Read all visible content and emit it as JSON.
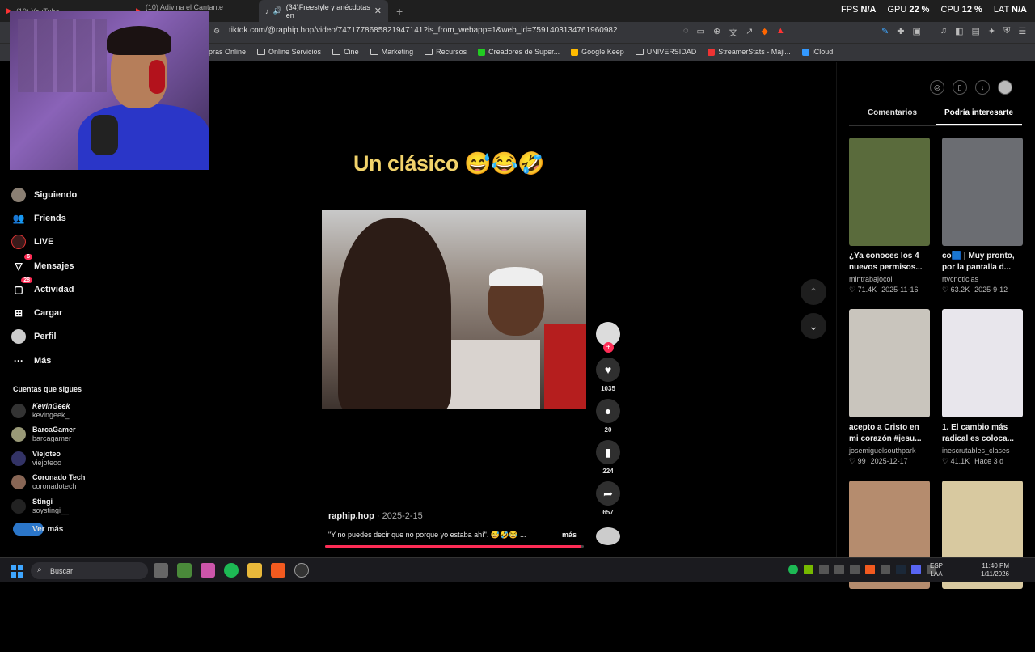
{
  "browser": {
    "tabs": [
      {
        "label": "(10) YouTube"
      },
      {
        "label": "(10) Adivina el Cantante Profesional"
      },
      {
        "label": "(34)Freestyle y anécdotas en"
      }
    ],
    "url": "tiktok.com/@raphip.hop/video/7471778685821947141?is_from_webapp=1&web_id=7591403134761960982",
    "bookmarks": [
      "pras Online",
      "Online Servicios",
      "Cine",
      "Marketing",
      "Recursos",
      "Creadores de Super...",
      "Google Keep",
      "UNIVERSIDAD",
      "StreamerStats - Maji...",
      "iCloud"
    ]
  },
  "hud": {
    "fps_label": "FPS",
    "fps_value": "N/A",
    "gpu_label": "GPU",
    "gpu_value": "22 %",
    "cpu_label": "CPU",
    "cpu_value": "12 %",
    "lat_label": "LAT",
    "lat_value": "N/A"
  },
  "nav": {
    "siguiendo": "Siguiendo",
    "friends": "Friends",
    "live": "LIVE",
    "mensajes": "Mensajes",
    "mensajes_badge": "6",
    "actividad": "Actividad",
    "actividad_badge": "28",
    "cargar": "Cargar",
    "perfil": "Perfil",
    "mas": "Más"
  },
  "follows": {
    "title": "Cuentas que sigues",
    "items": [
      {
        "name": "KevinGeek",
        "handle": "kevingeek_"
      },
      {
        "name": "BarcaGamer",
        "handle": "barcagamer"
      },
      {
        "name": "Viejoteo",
        "handle": "viejoteoo"
      },
      {
        "name": "Coronado Tech",
        "handle": "coronadotech"
      },
      {
        "name": "Stingi",
        "handle": "soystingi__"
      }
    ],
    "ver_mas": "Ver más"
  },
  "video": {
    "overlay_title": "Un clásico 😅😂🤣",
    "author": "raphip.hop",
    "date": " · 2025-2-15",
    "description": "\"Y no puedes decir que no porque yo estaba ahí\". 😅🤣😂 ...",
    "more": "más",
    "progress": 0.99,
    "likes": "1035",
    "comments": "20",
    "saves": "224",
    "shares": "657"
  },
  "sidebar": {
    "tab_comments": "Comentarios",
    "tab_suggested": "Podría interesarte",
    "cards": [
      {
        "title": "¿Ya conoces los 4 nuevos permisos...",
        "author": "mintrabajocol",
        "likes": "♡ 71.4K",
        "date": "2025-11-16",
        "color": "#5a6b3c"
      },
      {
        "title": "co🟦 | Muy pronto, por la pantalla d...",
        "author": "rtvcnoticias",
        "likes": "♡ 63.2K",
        "date": "2025-9-12",
        "color": "#6b6d72"
      },
      {
        "title": "acepto a Cristo en mi corazón #jesu...",
        "author": "josemiguelsouthpark",
        "likes": "♡ 99",
        "date": "2025-12-17",
        "color": "#c9c5bd"
      },
      {
        "title": "1. El cambio más radical es coloca...",
        "author": "inescrutables_clases",
        "likes": "♡ 41.1K",
        "date": "Hace 3 d",
        "color": "#e8e6ec"
      },
      {
        "title": "",
        "author": "",
        "likes": "",
        "date": "",
        "color": "#b58c6e"
      },
      {
        "title": "",
        "author": "",
        "likes": "",
        "date": "",
        "color": "#d8c9a0"
      }
    ]
  },
  "taskbar": {
    "search_placeholder": "Buscar",
    "lang_top": "ESP",
    "lang_bottom": "LAA",
    "time": "11:40 PM",
    "date": "1/11/2026"
  }
}
